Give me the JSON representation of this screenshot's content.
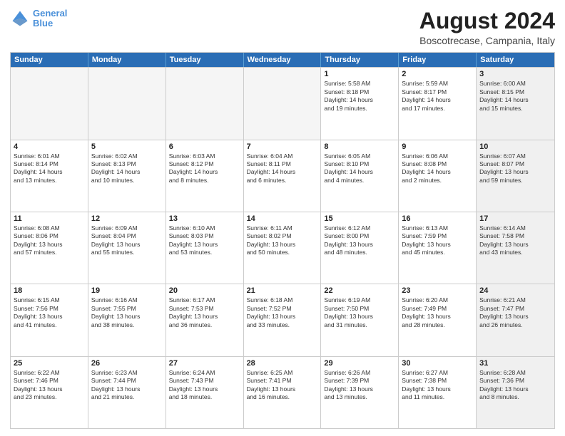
{
  "logo": {
    "line1": "General",
    "line2": "Blue"
  },
  "title": "August 2024",
  "location": "Boscotrecase, Campania, Italy",
  "weekdays": [
    "Sunday",
    "Monday",
    "Tuesday",
    "Wednesday",
    "Thursday",
    "Friday",
    "Saturday"
  ],
  "rows": [
    [
      {
        "day": "",
        "empty": true
      },
      {
        "day": "",
        "empty": true
      },
      {
        "day": "",
        "empty": true
      },
      {
        "day": "",
        "empty": true
      },
      {
        "day": "1",
        "text": "Sunrise: 5:58 AM\nSunset: 8:18 PM\nDaylight: 14 hours\nand 19 minutes."
      },
      {
        "day": "2",
        "text": "Sunrise: 5:59 AM\nSunset: 8:17 PM\nDaylight: 14 hours\nand 17 minutes."
      },
      {
        "day": "3",
        "shaded": true,
        "text": "Sunrise: 6:00 AM\nSunset: 8:15 PM\nDaylight: 14 hours\nand 15 minutes."
      }
    ],
    [
      {
        "day": "4",
        "text": "Sunrise: 6:01 AM\nSunset: 8:14 PM\nDaylight: 14 hours\nand 13 minutes."
      },
      {
        "day": "5",
        "text": "Sunrise: 6:02 AM\nSunset: 8:13 PM\nDaylight: 14 hours\nand 10 minutes."
      },
      {
        "day": "6",
        "text": "Sunrise: 6:03 AM\nSunset: 8:12 PM\nDaylight: 14 hours\nand 8 minutes."
      },
      {
        "day": "7",
        "text": "Sunrise: 6:04 AM\nSunset: 8:11 PM\nDaylight: 14 hours\nand 6 minutes."
      },
      {
        "day": "8",
        "text": "Sunrise: 6:05 AM\nSunset: 8:10 PM\nDaylight: 14 hours\nand 4 minutes."
      },
      {
        "day": "9",
        "text": "Sunrise: 6:06 AM\nSunset: 8:08 PM\nDaylight: 14 hours\nand 2 minutes."
      },
      {
        "day": "10",
        "shaded": true,
        "text": "Sunrise: 6:07 AM\nSunset: 8:07 PM\nDaylight: 13 hours\nand 59 minutes."
      }
    ],
    [
      {
        "day": "11",
        "text": "Sunrise: 6:08 AM\nSunset: 8:06 PM\nDaylight: 13 hours\nand 57 minutes."
      },
      {
        "day": "12",
        "text": "Sunrise: 6:09 AM\nSunset: 8:04 PM\nDaylight: 13 hours\nand 55 minutes."
      },
      {
        "day": "13",
        "text": "Sunrise: 6:10 AM\nSunset: 8:03 PM\nDaylight: 13 hours\nand 53 minutes."
      },
      {
        "day": "14",
        "text": "Sunrise: 6:11 AM\nSunset: 8:02 PM\nDaylight: 13 hours\nand 50 minutes."
      },
      {
        "day": "15",
        "text": "Sunrise: 6:12 AM\nSunset: 8:00 PM\nDaylight: 13 hours\nand 48 minutes."
      },
      {
        "day": "16",
        "text": "Sunrise: 6:13 AM\nSunset: 7:59 PM\nDaylight: 13 hours\nand 45 minutes."
      },
      {
        "day": "17",
        "shaded": true,
        "text": "Sunrise: 6:14 AM\nSunset: 7:58 PM\nDaylight: 13 hours\nand 43 minutes."
      }
    ],
    [
      {
        "day": "18",
        "text": "Sunrise: 6:15 AM\nSunset: 7:56 PM\nDaylight: 13 hours\nand 41 minutes."
      },
      {
        "day": "19",
        "text": "Sunrise: 6:16 AM\nSunset: 7:55 PM\nDaylight: 13 hours\nand 38 minutes."
      },
      {
        "day": "20",
        "text": "Sunrise: 6:17 AM\nSunset: 7:53 PM\nDaylight: 13 hours\nand 36 minutes."
      },
      {
        "day": "21",
        "text": "Sunrise: 6:18 AM\nSunset: 7:52 PM\nDaylight: 13 hours\nand 33 minutes."
      },
      {
        "day": "22",
        "text": "Sunrise: 6:19 AM\nSunset: 7:50 PM\nDaylight: 13 hours\nand 31 minutes."
      },
      {
        "day": "23",
        "text": "Sunrise: 6:20 AM\nSunset: 7:49 PM\nDaylight: 13 hours\nand 28 minutes."
      },
      {
        "day": "24",
        "shaded": true,
        "text": "Sunrise: 6:21 AM\nSunset: 7:47 PM\nDaylight: 13 hours\nand 26 minutes."
      }
    ],
    [
      {
        "day": "25",
        "text": "Sunrise: 6:22 AM\nSunset: 7:46 PM\nDaylight: 13 hours\nand 23 minutes."
      },
      {
        "day": "26",
        "text": "Sunrise: 6:23 AM\nSunset: 7:44 PM\nDaylight: 13 hours\nand 21 minutes."
      },
      {
        "day": "27",
        "text": "Sunrise: 6:24 AM\nSunset: 7:43 PM\nDaylight: 13 hours\nand 18 minutes."
      },
      {
        "day": "28",
        "text": "Sunrise: 6:25 AM\nSunset: 7:41 PM\nDaylight: 13 hours\nand 16 minutes."
      },
      {
        "day": "29",
        "text": "Sunrise: 6:26 AM\nSunset: 7:39 PM\nDaylight: 13 hours\nand 13 minutes."
      },
      {
        "day": "30",
        "text": "Sunrise: 6:27 AM\nSunset: 7:38 PM\nDaylight: 13 hours\nand 11 minutes."
      },
      {
        "day": "31",
        "shaded": true,
        "text": "Sunrise: 6:28 AM\nSunset: 7:36 PM\nDaylight: 13 hours\nand 8 minutes."
      }
    ]
  ]
}
